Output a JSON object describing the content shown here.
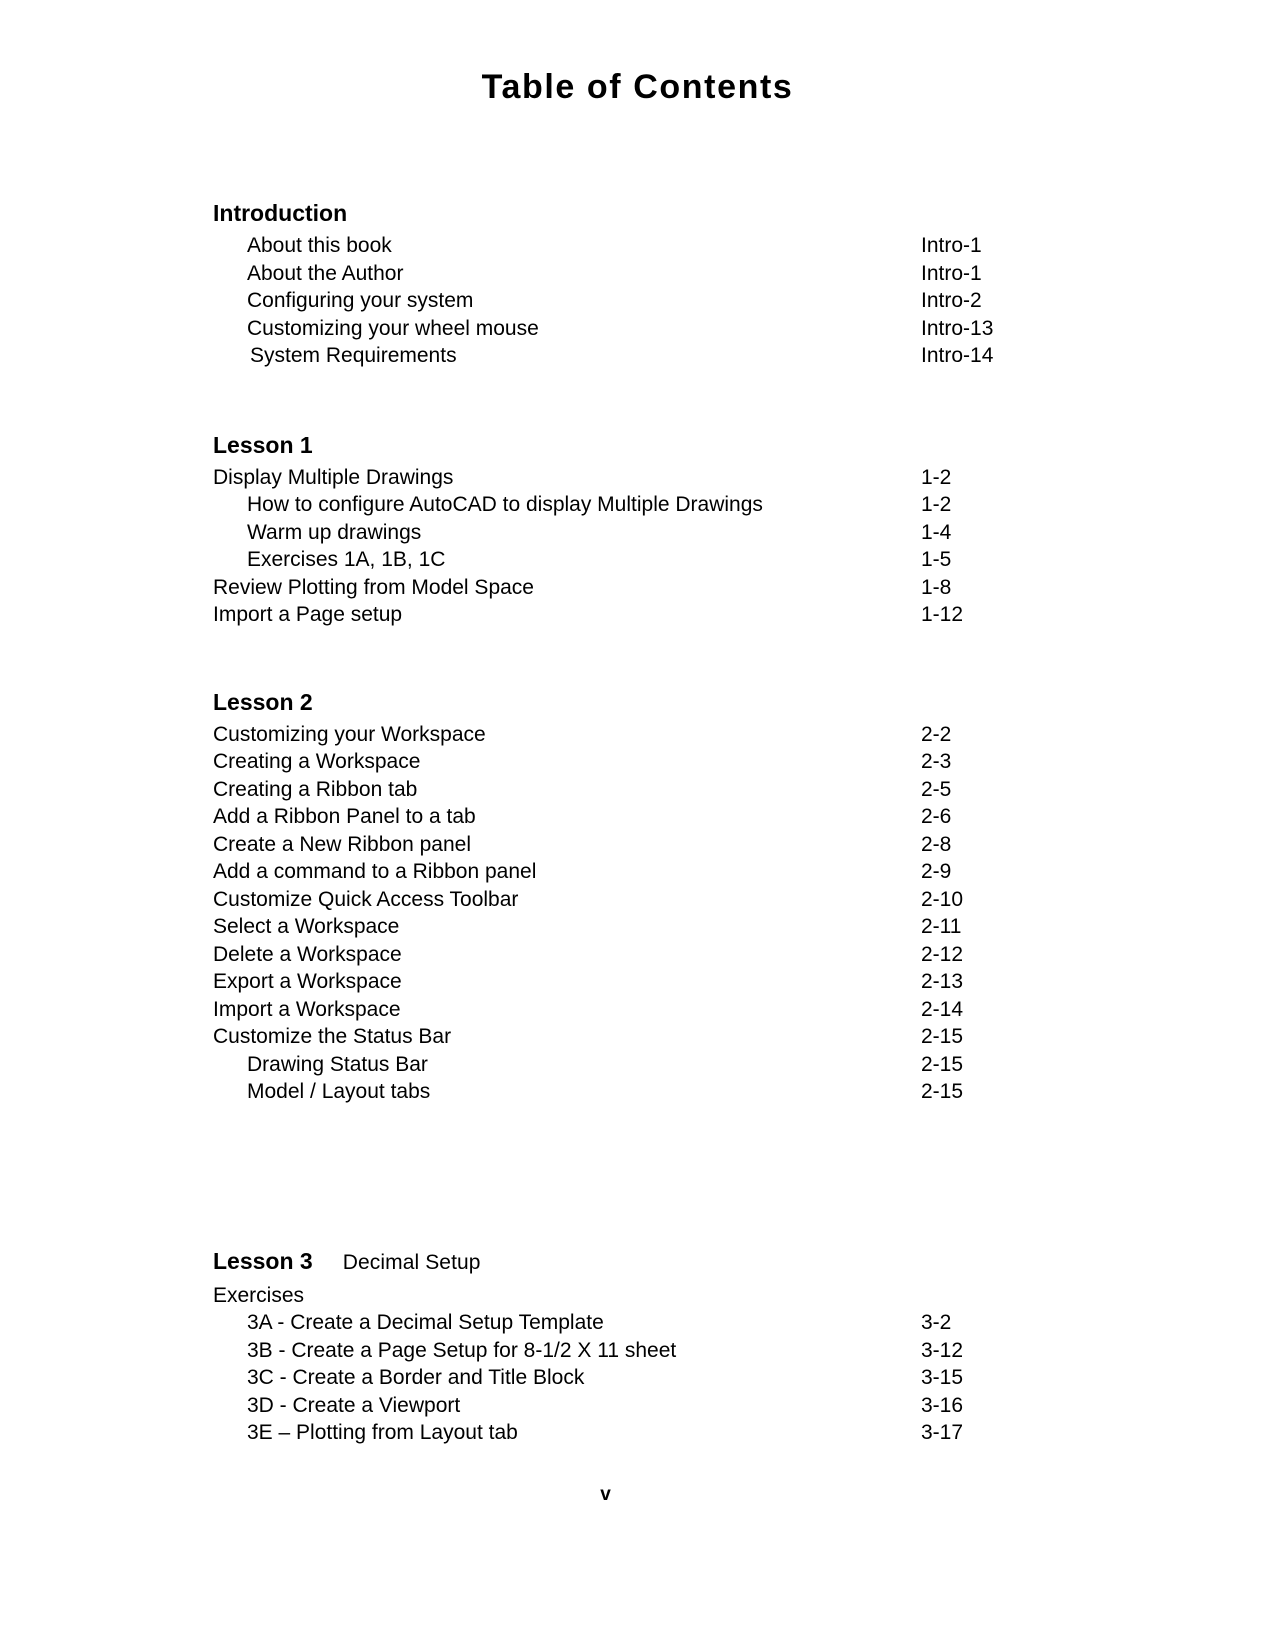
{
  "document": {
    "title": "Table of Contents",
    "page_label": "v"
  },
  "sections": [
    {
      "heading": "Introduction",
      "heading_note": "",
      "entries": [
        {
          "label": "About this book",
          "page": "Intro-1",
          "indent": 1
        },
        {
          "label": "About the Author",
          "page": "Intro-1",
          "indent": 1
        },
        {
          "label": "Configuring your system",
          "page": "Intro-2",
          "indent": 1
        },
        {
          "label": "Customizing your wheel mouse",
          "page": "Intro-13",
          "indent": 1
        },
        {
          "label": "System Requirements",
          "page": "Intro-14",
          "indent": 2
        }
      ]
    },
    {
      "heading": "Lesson 1",
      "heading_note": "",
      "entries": [
        {
          "label": "Display Multiple Drawings",
          "page": "1-2",
          "indent": 0
        },
        {
          "label": "How to configure AutoCAD to display Multiple Drawings",
          "page": "1-2",
          "indent": 1
        },
        {
          "label": "Warm up drawings",
          "page": "1-4",
          "indent": 1
        },
        {
          "label": "Exercises  1A,  1B,  1C",
          "page": "1-5",
          "indent": 1
        },
        {
          "label": "Review Plotting from Model Space",
          "page": "1-8",
          "indent": 0
        },
        {
          "label": "Import a Page setup",
          "page": "1-12",
          "indent": 0
        }
      ]
    },
    {
      "heading": "Lesson 2",
      "heading_note": "",
      "entries": [
        {
          "label": "Customizing your Workspace",
          "page": "2-2",
          "indent": 0
        },
        {
          "label": "Creating a Workspace",
          "page": "2-3",
          "indent": 0
        },
        {
          "label": "Creating a Ribbon tab",
          "page": "2-5",
          "indent": 0
        },
        {
          "label": "Add a Ribbon Panel to a tab",
          "page": "2-6",
          "indent": 0
        },
        {
          "label": "Create a New Ribbon panel",
          "page": "2-8",
          "indent": 0
        },
        {
          "label": "Add a command to a Ribbon panel",
          "page": "2-9",
          "indent": 0
        },
        {
          "label": "Customize Quick Access Toolbar",
          "page": "2-10",
          "indent": 0
        },
        {
          "label": "Select a Workspace",
          "page": "2-11",
          "indent": 0
        },
        {
          "label": "Delete a Workspace",
          "page": "2-12",
          "indent": 0
        },
        {
          "label": "Export a Workspace",
          "page": "2-13",
          "indent": 0
        },
        {
          "label": "Import a Workspace",
          "page": "2-14",
          "indent": 0
        },
        {
          "label": "Customize the Status Bar",
          "page": "2-15",
          "indent": 0
        },
        {
          "label": "Drawing Status Bar",
          "page": "2-15",
          "indent": 1
        },
        {
          "label": "Model / Layout tabs",
          "page": "2-15",
          "indent": 1
        }
      ]
    },
    {
      "heading": "Lesson 3",
      "heading_note": "Decimal Setup",
      "entries": [
        {
          "label": "Exercises",
          "page": "",
          "indent": 0
        },
        {
          "label": "3A - Create a Decimal Setup Template",
          "page": "3-2",
          "indent": 1
        },
        {
          "label": "3B - Create a Page Setup for 8-1/2 X 11 sheet",
          "page": "3-12",
          "indent": 1
        },
        {
          "label": "3C - Create a Border and Title Block",
          "page": "3-15",
          "indent": 1
        },
        {
          "label": "3D - Create a Viewport",
          "page": "3-16",
          "indent": 1
        },
        {
          "label": "3E – Plotting from Layout tab",
          "page": "3-17",
          "indent": 1
        }
      ]
    }
  ]
}
